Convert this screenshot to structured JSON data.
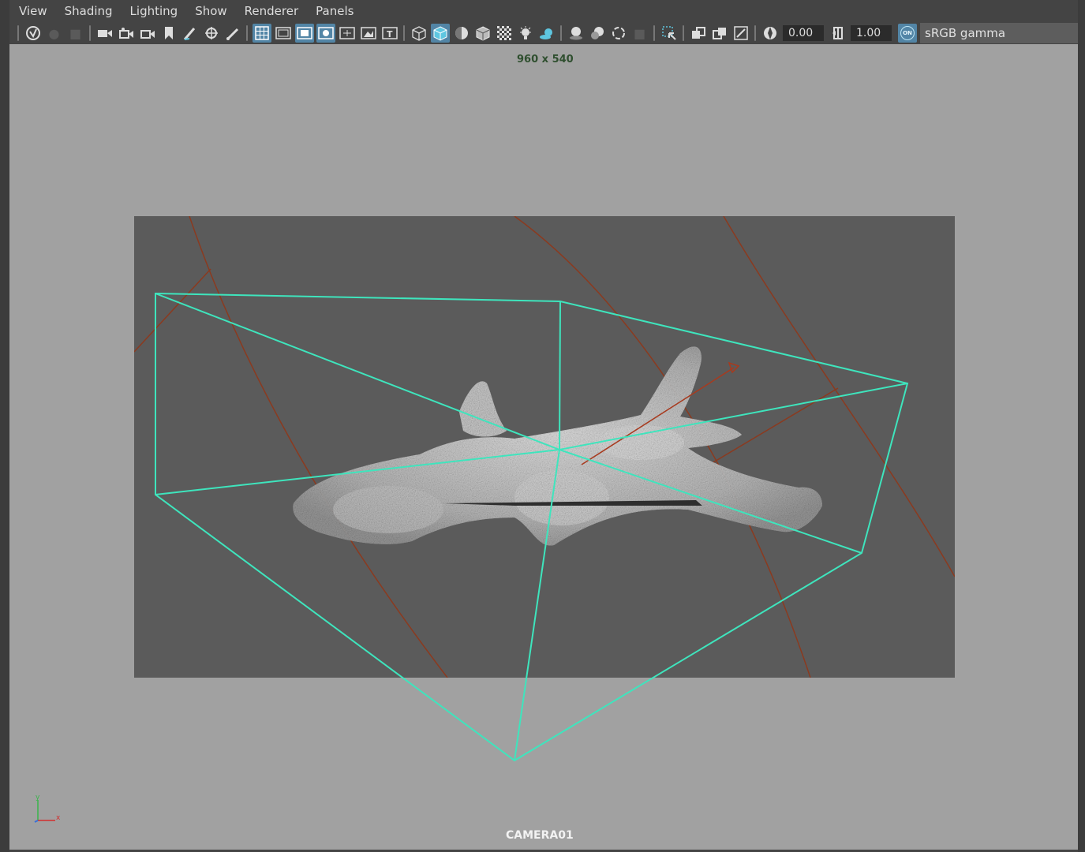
{
  "menu": [
    "View",
    "Shading",
    "Lighting",
    "Show",
    "Renderer",
    "Panels"
  ],
  "toolbar": {
    "exposure_value": "0.00",
    "gamma_value": "1.00",
    "color_management_badge": "ON",
    "color_space": "sRGB gamma"
  },
  "viewport": {
    "resolution_label": "960 x 540",
    "camera_name": "CAMERA01",
    "axis_labels": {
      "y": "y",
      "x": "x"
    }
  },
  "colors": {
    "bounding_box": "#3ee5bd",
    "guides": "#8b3a1f",
    "accent": "#5285a6"
  }
}
